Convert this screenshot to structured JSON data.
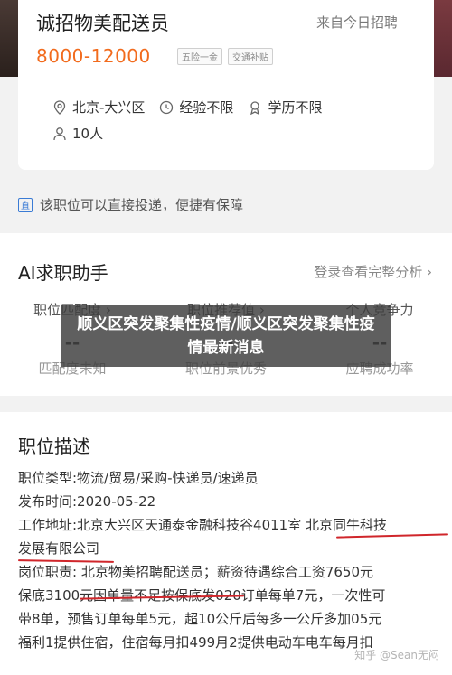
{
  "job": {
    "title": "诚招物美配送员",
    "post_time": "来自今日招聘",
    "salary": "8000-12000",
    "tags": [
      "五险一金",
      "交通补贴"
    ],
    "location": "北京-大兴区",
    "experience": "经验不限",
    "education": "学历不限",
    "headcount": "10人"
  },
  "notice": {
    "badge": "直",
    "text": "该职位可以直接投递，便捷有保障"
  },
  "ai": {
    "title": "AI求职助手",
    "link": "登录查看完整分析 ›",
    "stats": [
      {
        "label": "职位匹配度 ›",
        "value": "--",
        "sub": "匹配度未知"
      },
      {
        "label": "职位推荐值 ›",
        "value": "--",
        "sub": "职位前景优秀"
      },
      {
        "label": "个人竞争力",
        "value": "--",
        "sub": "应聘成功率"
      }
    ]
  },
  "overlay": {
    "text": "顺义区突发聚集性疫情/顺义区突发聚集性疫情最新消息"
  },
  "description": {
    "title": "职位描述",
    "lines": [
      "职位类型:物流/贸易/采购-快递员/速递员",
      "发布时间:2020-05-22",
      "工作地址:北京大兴区天通泰金融科技谷4011室 北京同牛科技",
      "发展有限公司",
      "岗位职责: 北京物美招聘配送员；薪资待遇综合工资7650元",
      "保底3100元因单量不足按保底发020订单每单7元，一次性可",
      "带8单，预售订单每单5元，超10公斤后每多一公斤多加05元",
      "福利1提供住宿，住宿每月扣499月2提供电动车电车每月扣"
    ]
  },
  "watermark": "知乎 @Sean无闷",
  "colors": {
    "accent": "#f26b1d",
    "underline": "#d0262b",
    "link": "#3a7bd5"
  }
}
